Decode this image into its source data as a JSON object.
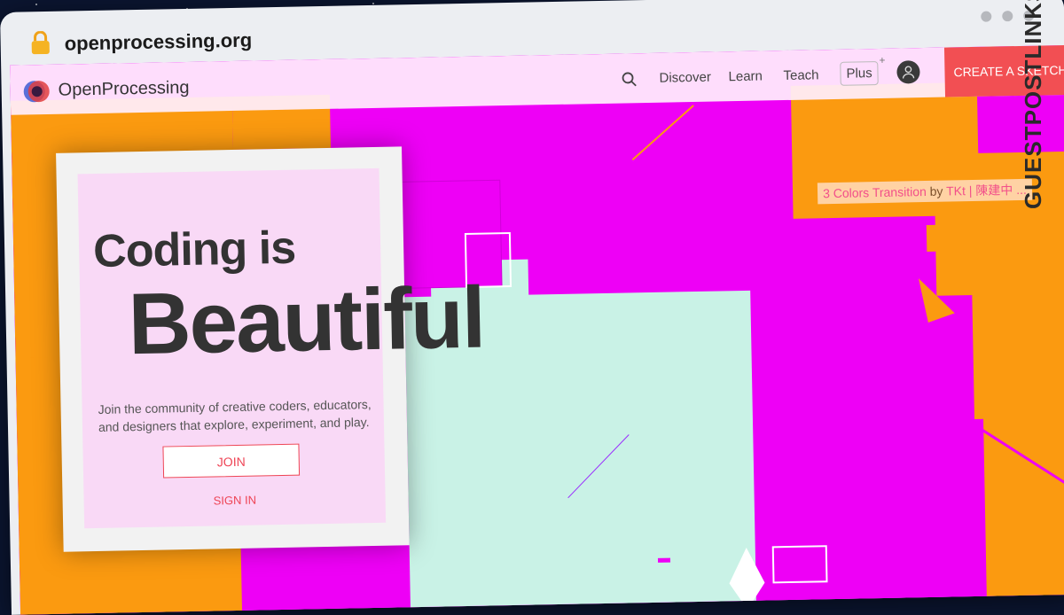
{
  "browser": {
    "url": "openprocessing.org",
    "icons": {
      "lock": "lock-icon"
    }
  },
  "navbar": {
    "logo_text": "OpenProcessing",
    "items": [
      "Discover",
      "Learn",
      "Teach",
      "Plus"
    ],
    "create_button": "CREATE A SKETCH",
    "icons": {
      "search": "search-icon",
      "avatar": "user-avatar-icon"
    }
  },
  "sketch_credit": {
    "title": "3 Colors Transition",
    "by": "by",
    "author": "TKt | 陳建中 ..."
  },
  "hero": {
    "title_line1": "Coding is",
    "title_line2": "Beautiful",
    "description": "Join the community of creative coders, educators, and designers that explore, experiment, and play.",
    "join_label": "JOIN",
    "signin_label": "SIGN IN"
  },
  "watermark": {
    "text": "GUESTPOSTLINKS"
  },
  "colors": {
    "magenta": "#ee00f6",
    "orange": "#fb9a10",
    "mint": "#c9f2e6",
    "accent_red": "#f24f53"
  }
}
